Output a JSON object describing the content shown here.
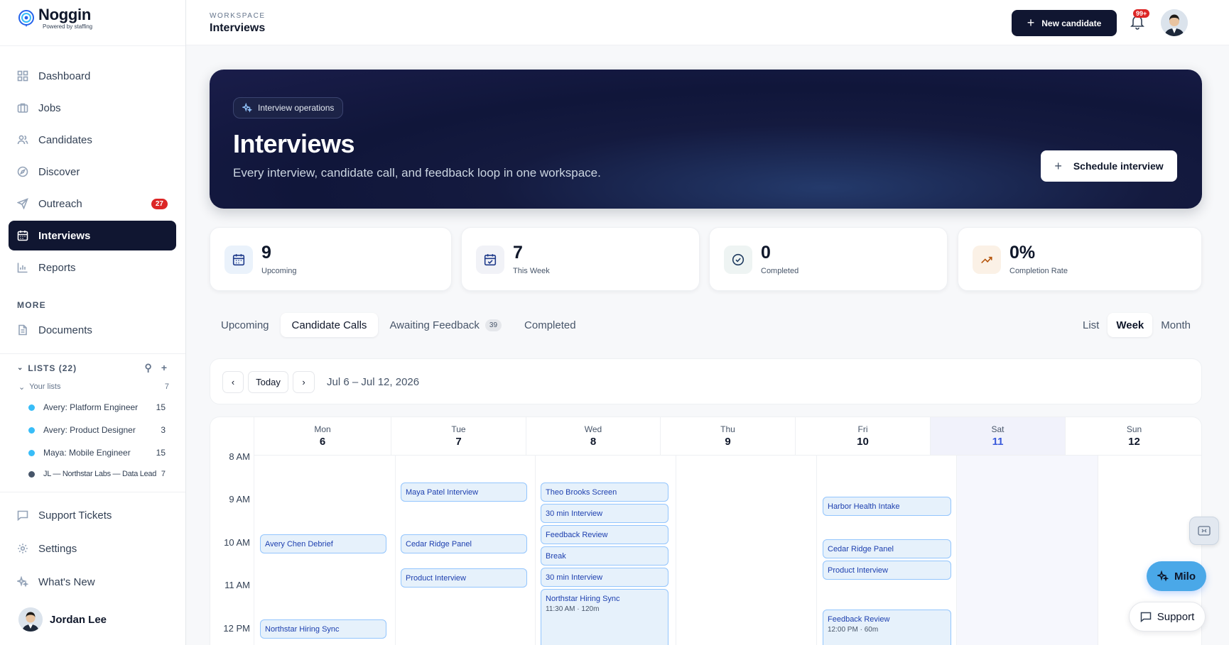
{
  "brand": {
    "name": "Noggin",
    "tagline": "Powered by staffing"
  },
  "sidebar": {
    "nav": [
      {
        "label": "Dashboard",
        "icon": "grid-icon"
      },
      {
        "label": "Jobs",
        "icon": "briefcase-icon"
      },
      {
        "label": "Candidates",
        "icon": "users-icon"
      },
      {
        "label": "Discover",
        "icon": "compass-icon"
      },
      {
        "label": "Outreach",
        "icon": "send-icon",
        "badge": "27"
      },
      {
        "label": "Interviews",
        "icon": "calendar-icon",
        "active": true
      },
      {
        "label": "Reports",
        "icon": "bar-chart-icon"
      }
    ],
    "more_label": "MORE",
    "documents_label": "Documents",
    "lists_label": "LISTS (22)",
    "your_lists_label": "Your lists",
    "your_lists_count": "7",
    "lists": [
      {
        "name": "Avery: Platform Engineer",
        "count": "15"
      },
      {
        "name": "Avery: Product Designer",
        "count": "3"
      },
      {
        "name": "Maya: Mobile Engineer",
        "count": "15"
      },
      {
        "name": "JL — Northstar Labs — Data Lead",
        "count": "7"
      }
    ],
    "bottom": [
      {
        "label": "Support Tickets",
        "icon": "chat-icon"
      },
      {
        "label": "Settings",
        "icon": "gear-icon"
      },
      {
        "label": "What's New",
        "icon": "sparkle-icon"
      }
    ],
    "user_name": "Jordan Lee"
  },
  "topbar": {
    "workspace_label": "WORKSPACE",
    "workspace_title": "Interviews",
    "new_candidate_label": "New candidate",
    "notification_badge": "99+"
  },
  "hero": {
    "chip": "Interview operations",
    "title": "Interviews",
    "subtitle": "Every interview, candidate call, and feedback loop in one workspace.",
    "button": "Schedule interview"
  },
  "stats": [
    {
      "value": "9",
      "label": "Upcoming"
    },
    {
      "value": "7",
      "label": "This Week"
    },
    {
      "value": "0",
      "label": "Completed"
    },
    {
      "value": "0%",
      "label": "Completion Rate"
    }
  ],
  "tabs": [
    {
      "label": "Upcoming"
    },
    {
      "label": "Candidate Calls",
      "active": true
    },
    {
      "label": "Awaiting Feedback",
      "badge": "39"
    },
    {
      "label": "Completed"
    }
  ],
  "views": [
    "List",
    "Week",
    "Month"
  ],
  "calendar": {
    "today_label": "Today",
    "range": "Jul 6 – Jul 12, 2026",
    "days": [
      {
        "name": "Mon",
        "date": "6"
      },
      {
        "name": "Tue",
        "date": "7"
      },
      {
        "name": "Wed",
        "date": "8"
      },
      {
        "name": "Thu",
        "date": "9"
      },
      {
        "name": "Fri",
        "date": "10"
      },
      {
        "name": "Sat",
        "date": "11"
      },
      {
        "name": "Sun",
        "date": "12"
      }
    ],
    "hours": [
      "8 AM",
      "9 AM",
      "10 AM",
      "11 AM",
      "12 PM"
    ],
    "events": {
      "mon": [
        "Avery Chen Debrief",
        "Northstar Hiring Sync"
      ],
      "tue": [
        "Maya Patel Interview",
        "Cedar Ridge Panel",
        "Product Interview"
      ],
      "wed": [
        "Theo Brooks Screen",
        "30 min Interview",
        "Feedback Review",
        "Break",
        "30 min Interview",
        "Northstar Hiring Sync"
      ],
      "wed_sync_time": "11:30 AM · 120m",
      "fri": [
        "Harbor Health Intake",
        "Cedar Ridge Panel",
        "Product Interview",
        "Feedback Review"
      ],
      "fri_review_time": "12:00 PM · 60m"
    }
  },
  "floating": {
    "milo_label": "Milo",
    "support_label": "Support"
  }
}
